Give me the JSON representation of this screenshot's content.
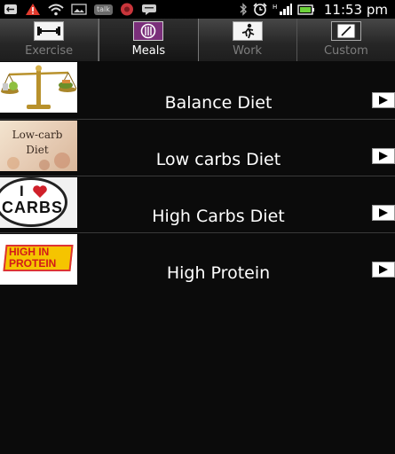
{
  "statusbar": {
    "time": "11:53 pm",
    "talk": "talk",
    "icons": [
      "usb-icon",
      "warning-icon",
      "wifi-icon",
      "gallery-icon",
      "talk-icon",
      "music-icon",
      "sms-icon",
      "bluetooth-icon",
      "alarm-icon",
      "signal-icon",
      "battery-icon"
    ]
  },
  "tabs": [
    {
      "label": "Exercise",
      "icon": "dumbbell-icon",
      "active": false
    },
    {
      "label": "Meals",
      "icon": "plate-icon",
      "active": true
    },
    {
      "label": "Work",
      "icon": "running-man-icon",
      "active": false
    },
    {
      "label": "Custom",
      "icon": "edit-icon",
      "active": false
    }
  ],
  "items": [
    {
      "label": "Balance Diet",
      "image": "balance-scale-image"
    },
    {
      "label": "Low carbs Diet",
      "image": "low-carb-image",
      "image_text": "Low-carb Diet"
    },
    {
      "label": "High Carbs Diet",
      "image": "i-love-carbs-image",
      "image_text_1": "I",
      "image_text_2": "CARBS"
    },
    {
      "label": "High Protein",
      "image": "high-in-protein-image",
      "image_text_1": "HIGH IN",
      "image_text_2": "PROTEIN"
    }
  ],
  "colors": {
    "background": "#0b0b0b",
    "tab_active_text": "#ffffff",
    "tab_inactive_text": "#7d7d7d",
    "divider": "#3a3a3a"
  }
}
